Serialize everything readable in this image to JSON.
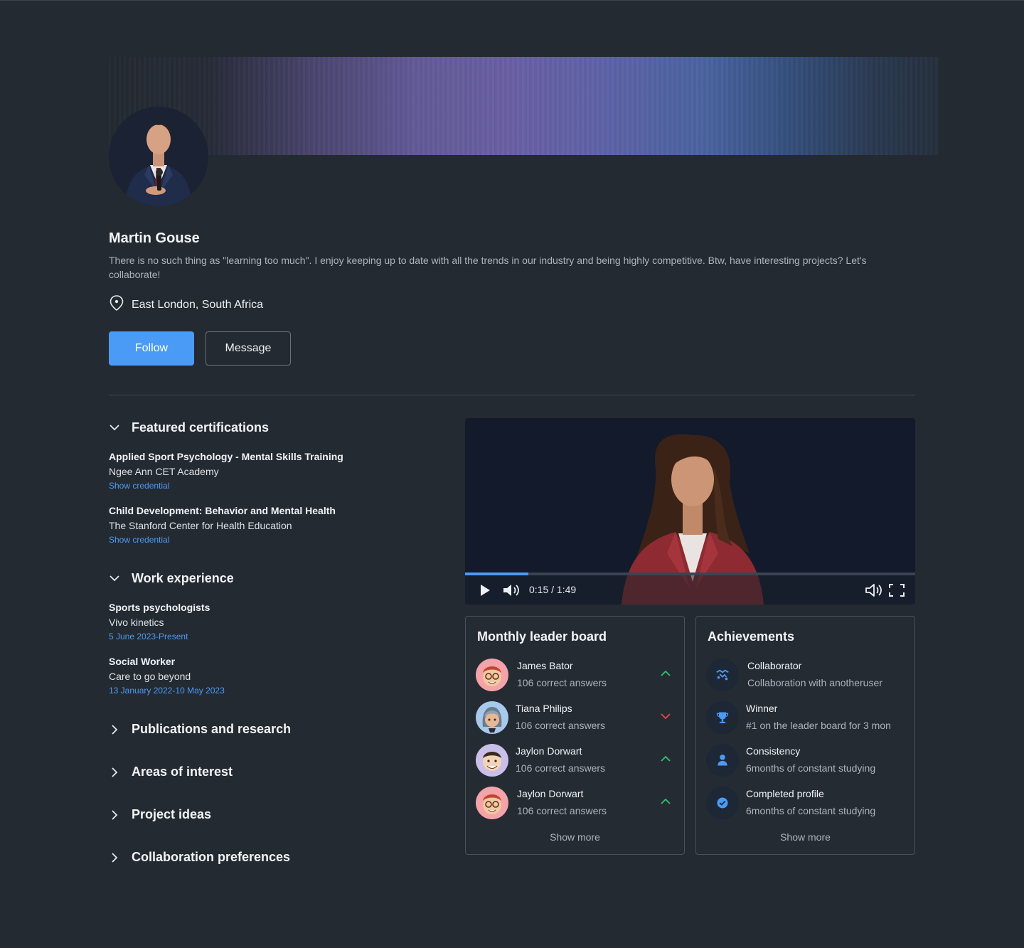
{
  "profile": {
    "name": "Martin Gouse",
    "bio": "There is no such thing as \"learning too much\". I enjoy keeping up to date with all the trends in our industry and being highly competitive. Btw, have interesting projects? Let's collaborate!",
    "location": "East London, South Africa",
    "follow_label": "Follow",
    "message_label": "Message"
  },
  "certifications": {
    "title": "Featured certifications",
    "items": [
      {
        "title": "Applied Sport Psychology - Mental Skills Training",
        "org": "Ngee Ann CET Academy",
        "link": "Show credential"
      },
      {
        "title": "Child Development: Behavior and Mental Health",
        "org": "The Stanford Center for Health Education",
        "link": "Show credential"
      }
    ]
  },
  "work": {
    "title": "Work experience",
    "items": [
      {
        "title": "Sports psychologists",
        "org": "Vivo kinetics",
        "dates": "5 June 2023-Present"
      },
      {
        "title": "Social Worker",
        "org": "Care to go beyond",
        "dates": "13 January 2022-10 May 2023"
      }
    ]
  },
  "collapsed_sections": [
    "Publications and research",
    "Areas of interest",
    "Project ideas",
    "Collaboration preferences"
  ],
  "video": {
    "time": "0:15 / 1:49",
    "progress": 0.14
  },
  "leaderboard": {
    "title": "Monthly leader board",
    "show_more": "Show more",
    "rows": [
      {
        "name": "James Bator",
        "score": "106 correct answers",
        "trend": "up"
      },
      {
        "name": "Tiana Philips",
        "score": "106 correct answers",
        "trend": "down"
      },
      {
        "name": "Jaylon Dorwart",
        "score": "106 correct answers",
        "trend": "up"
      },
      {
        "name": "Jaylon Dorwart",
        "score": "106 correct answers",
        "trend": "up"
      }
    ]
  },
  "achievements": {
    "title": "Achievements",
    "show_more": "Show more",
    "rows": [
      {
        "name": "Collaborator",
        "desc": "Collaboration with anotheruser",
        "icon": "handshake-icon"
      },
      {
        "name": "Winner",
        "desc": "#1 on the leader board for 3 mon",
        "icon": "trophy-icon"
      },
      {
        "name": "Consistency",
        "desc": "6months of constant studying",
        "icon": "person-icon"
      },
      {
        "name": "Completed profile",
        "desc": "6months of constant studying",
        "icon": "check-badge-icon"
      }
    ]
  },
  "colors": {
    "background": "#242a31",
    "accent": "#4a9bf6",
    "trend_up": "#2fc46b",
    "trend_down": "#e5484d"
  }
}
